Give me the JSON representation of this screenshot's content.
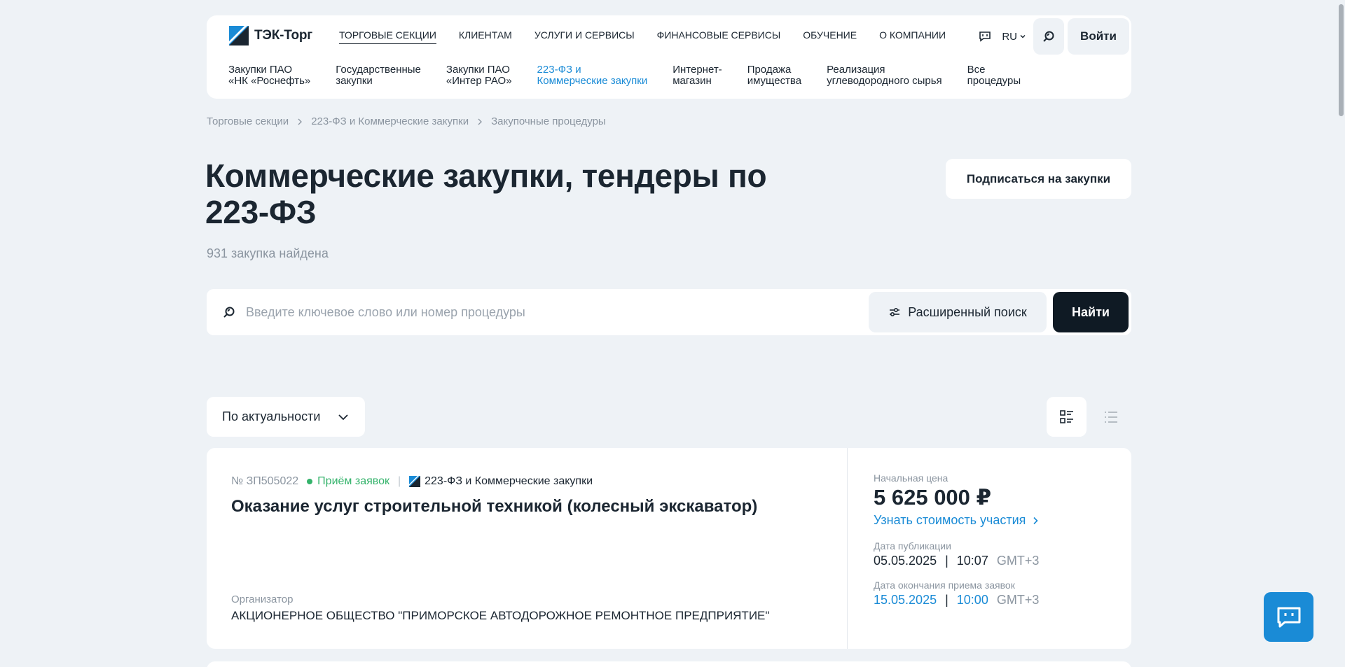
{
  "header": {
    "logo_text": "ТЭК-Торг",
    "nav": [
      {
        "label": "Торговые секции"
      },
      {
        "label": "Клиентам"
      },
      {
        "label": "Услуги и сервисы"
      },
      {
        "label": "Финансовые сервисы"
      },
      {
        "label": "Обучение"
      },
      {
        "label": "О компании"
      }
    ],
    "active_nav_index": 0,
    "lang": "RU",
    "login_label": "Войти",
    "subnav": [
      {
        "label": "Закупки ПАО\n«НК «Роснефть»"
      },
      {
        "label": "Государственные\nзакупки"
      },
      {
        "label": "Закупки ПАО\n«Интер РАО»"
      },
      {
        "label": "223-ФЗ и\nКоммерческие закупки"
      },
      {
        "label": "Интернет-\nмагазин"
      },
      {
        "label": "Продажа\nимущества"
      },
      {
        "label": "Реализация\nуглеводородного сырья"
      },
      {
        "label": "Все\nпроцедуры"
      }
    ],
    "active_subnav_index": 3
  },
  "breadcrumb": [
    "Торговые секции",
    "223-ФЗ и Коммерческие закупки",
    "Закупочные процедуры"
  ],
  "page": {
    "title": "Коммерческие закупки, тендеры по 223-ФЗ",
    "found_text": "931 закупка найдена",
    "subscribe_label": "Подписаться на закупки"
  },
  "search": {
    "placeholder": "Введите ключевое слово или номер процедуры",
    "value": "",
    "advanced_label": "Расширенный поиск",
    "find_label": "Найти"
  },
  "sort": {
    "selected": "По актуальности"
  },
  "procedures": [
    {
      "number": "№ ЗП505022",
      "status": "Приём заявок",
      "section": "223-ФЗ и Коммерческие закупки",
      "title": "Оказание услуг строительной техникой (колесный экскаватор)",
      "organizer_label": "Организатор",
      "organizer": "АКЦИОНЕРНОЕ ОБЩЕСТВО \"ПРИМОРСКОЕ АВТОДОРОЖНОЕ РЕМОНТНОЕ ПРЕДПРИЯТИЕ\"",
      "price_label": "Начальная цена",
      "price": "5 625 000 ₽",
      "cost_link": "Узнать стоимость участия",
      "pub_label": "Дата публикации",
      "pub_date": "05.05.2025",
      "pub_time": "10:07",
      "pub_tz": "GMT+3",
      "end_label": "Дата окончания приема заявок",
      "end_date": "15.05.2025",
      "end_time": "10:00",
      "end_tz": "GMT+3"
    }
  ],
  "colors": {
    "background": "#eef2f6",
    "accent": "#1a8bd6",
    "status_green": "#34b36b",
    "dark_button": "#0f1a24"
  }
}
